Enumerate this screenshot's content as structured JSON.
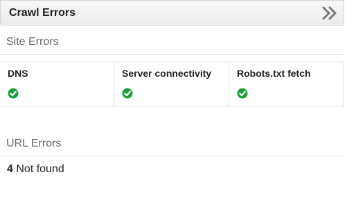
{
  "widget": {
    "title": "Crawl Errors",
    "expand_icon": "double-chevron-right-icon"
  },
  "site_errors": {
    "title": "Site Errors",
    "items": [
      {
        "label": "DNS",
        "status": "ok",
        "status_icon": "check-circle-icon"
      },
      {
        "label": "Server connectivity",
        "status": "ok",
        "status_icon": "check-circle-icon"
      },
      {
        "label": "Robots.txt fetch",
        "status": "ok",
        "status_icon": "check-circle-icon"
      }
    ]
  },
  "url_errors": {
    "title": "URL Errors",
    "rows": [
      {
        "count": "4",
        "label": "Not found"
      }
    ]
  },
  "colors": {
    "ok_green": "#1e9e3a",
    "chevron_gray": "#777777"
  }
}
